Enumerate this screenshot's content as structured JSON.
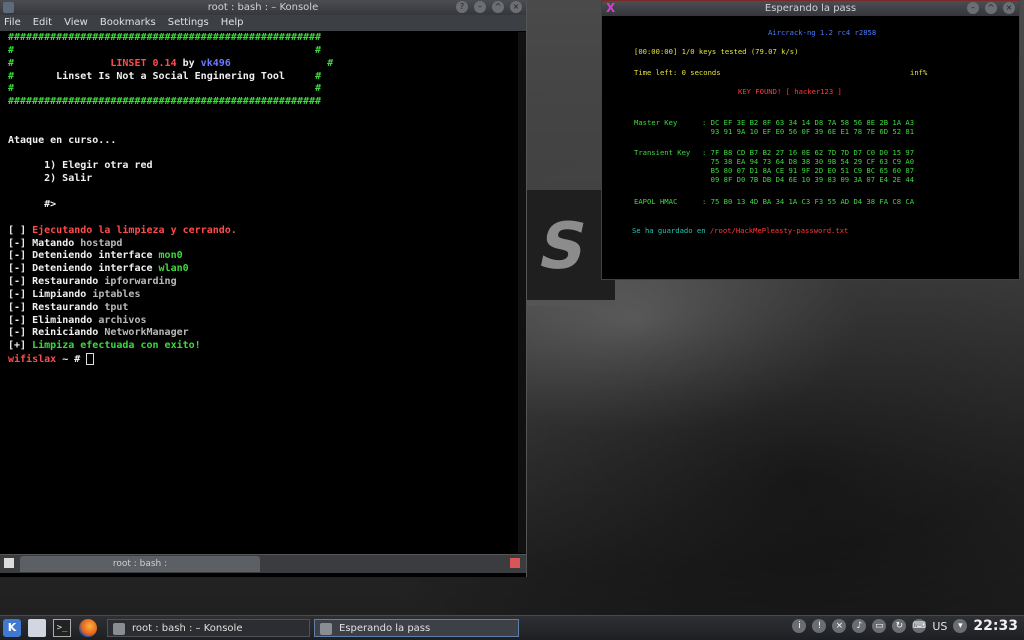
{
  "konsole": {
    "title": "root : bash : – Konsole",
    "menu": [
      "File",
      "Edit",
      "View",
      "Bookmarks",
      "Settings",
      "Help"
    ],
    "tab_label": "root : bash :",
    "lines": [
      {
        "segments": [
          {
            "text": "####################################################",
            "color": "green"
          }
        ]
      },
      {
        "segments": [
          {
            "text": "#                                                  #",
            "color": "green"
          }
        ]
      },
      {
        "segments": [
          {
            "text": "#",
            "color": "green"
          },
          {
            "text": "                LINSET 0.14 ",
            "color": "red"
          },
          {
            "text": "by ",
            "color": "white"
          },
          {
            "text": "vk496",
            "color": "blue"
          },
          {
            "text": "                #",
            "color": "green"
          }
        ]
      },
      {
        "segments": [
          {
            "text": "#",
            "color": "green"
          },
          {
            "text": "       Linset Is Not a Social Enginering Tool     ",
            "color": "white"
          },
          {
            "text": "#",
            "color": "green"
          }
        ]
      },
      {
        "segments": [
          {
            "text": "#                                                  #",
            "color": "green"
          }
        ]
      },
      {
        "segments": [
          {
            "text": "####################################################",
            "color": "green"
          }
        ]
      },
      {
        "segments": [
          {
            "text": "",
            "color": "white"
          }
        ]
      },
      {
        "segments": [
          {
            "text": "",
            "color": "white"
          }
        ]
      },
      {
        "segments": [
          {
            "text": "Ataque en curso...",
            "color": "white"
          }
        ]
      },
      {
        "segments": [
          {
            "text": "",
            "color": "white"
          }
        ]
      },
      {
        "segments": [
          {
            "text": "      1) Elegir otra red",
            "color": "white"
          }
        ]
      },
      {
        "segments": [
          {
            "text": "      2) Salir",
            "color": "white"
          }
        ]
      },
      {
        "segments": [
          {
            "text": "",
            "color": "white"
          }
        ]
      },
      {
        "segments": [
          {
            "text": "      #>",
            "color": "white"
          }
        ]
      },
      {
        "segments": [
          {
            "text": "",
            "color": "white"
          }
        ]
      },
      {
        "segments": [
          {
            "text": "[ ] ",
            "color": "white"
          },
          {
            "text": "Ejecutando la limpieza y cerrando.",
            "color": "red"
          }
        ]
      },
      {
        "segments": [
          {
            "text": "[-] ",
            "color": "white"
          },
          {
            "text": "Matando ",
            "color": "white"
          },
          {
            "text": "hostapd",
            "color": "gray"
          }
        ]
      },
      {
        "segments": [
          {
            "text": "[-] ",
            "color": "white"
          },
          {
            "text": "Deteniendo interface ",
            "color": "white"
          },
          {
            "text": "mon0",
            "color": "green"
          }
        ]
      },
      {
        "segments": [
          {
            "text": "[-] ",
            "color": "white"
          },
          {
            "text": "Deteniendo interface ",
            "color": "white"
          },
          {
            "text": "wlan0",
            "color": "green"
          }
        ]
      },
      {
        "segments": [
          {
            "text": "[-] ",
            "color": "white"
          },
          {
            "text": "Restaurando ",
            "color": "white"
          },
          {
            "text": "ipforwarding",
            "color": "gray"
          }
        ]
      },
      {
        "segments": [
          {
            "text": "[-] ",
            "color": "white"
          },
          {
            "text": "Limpiando ",
            "color": "white"
          },
          {
            "text": "iptables",
            "color": "gray"
          }
        ]
      },
      {
        "segments": [
          {
            "text": "[-] ",
            "color": "white"
          },
          {
            "text": "Restaurando ",
            "color": "white"
          },
          {
            "text": "tput",
            "color": "gray"
          }
        ]
      },
      {
        "segments": [
          {
            "text": "[-] ",
            "color": "white"
          },
          {
            "text": "Eliminando ",
            "color": "white"
          },
          {
            "text": "archivos",
            "color": "gray"
          }
        ]
      },
      {
        "segments": [
          {
            "text": "[-] ",
            "color": "white"
          },
          {
            "text": "Reiniciando ",
            "color": "white"
          },
          {
            "text": "NetworkManager",
            "color": "gray"
          }
        ]
      },
      {
        "segments": [
          {
            "text": "[+] ",
            "color": "white"
          },
          {
            "text": "Limpiza efectuada con exito!",
            "color": "green"
          }
        ]
      }
    ],
    "prompt_user": "wifislax",
    "prompt_rest": " ~ # "
  },
  "aircrack": {
    "title": "Esperando la pass",
    "header": "Aircrack-ng 1.2 rc4 r2858",
    "keys_tested": "[00:00:00] 1/0 keys tested (79.07 k/s)",
    "time_left": "Time left: 0 seconds",
    "percent": "inf%",
    "key_found": "KEY FOUND! [ hacker123 ]",
    "master_key_label": "Master Key",
    "master_key": [
      ": DC EF 3E B2 8F 63 34 14 D8 7A 58 56 8E 2B 1A A3",
      "  93 91 9A 10 EF E0 56 0F 39 6E E1 78 7E 6D 52 81"
    ],
    "transient_key_label": "Transient Key",
    "transient_key": [
      ": 7F B8 CD B7 B2 27 16 0E 62 7D 7D D7 C0 D0 15 97",
      "  75 38 EA 94 73 64 D8 38 30 9B 54 29 CF 63 C9 A0",
      "  B5 80 07 D1 8A CE 91 9F 2D E0 51 C9 BC 65 60 87",
      "  09 8F D0 7B DB D4 6E 10 39 83 09 3A 07 E4 2E 44"
    ],
    "eapol_label": "EAPOL HMAC",
    "eapol": ": 75 B0 13 4D BA 34 1A C3 F3 55 AD D4 38 FA C8 CA",
    "saved_prefix": "Se ha guardado en ",
    "saved_path": "/root/HackMePleasty-password.txt"
  },
  "taskbar": {
    "tasks": [
      "root : bash : – Konsole",
      "Esperando la pass"
    ],
    "lang": "US",
    "clock": "22:33"
  },
  "icons": {
    "launcher": "kde-menu-icon",
    "files": "dolphin-icon",
    "terminal": "terminal-icon",
    "browser": "firefox-icon"
  }
}
